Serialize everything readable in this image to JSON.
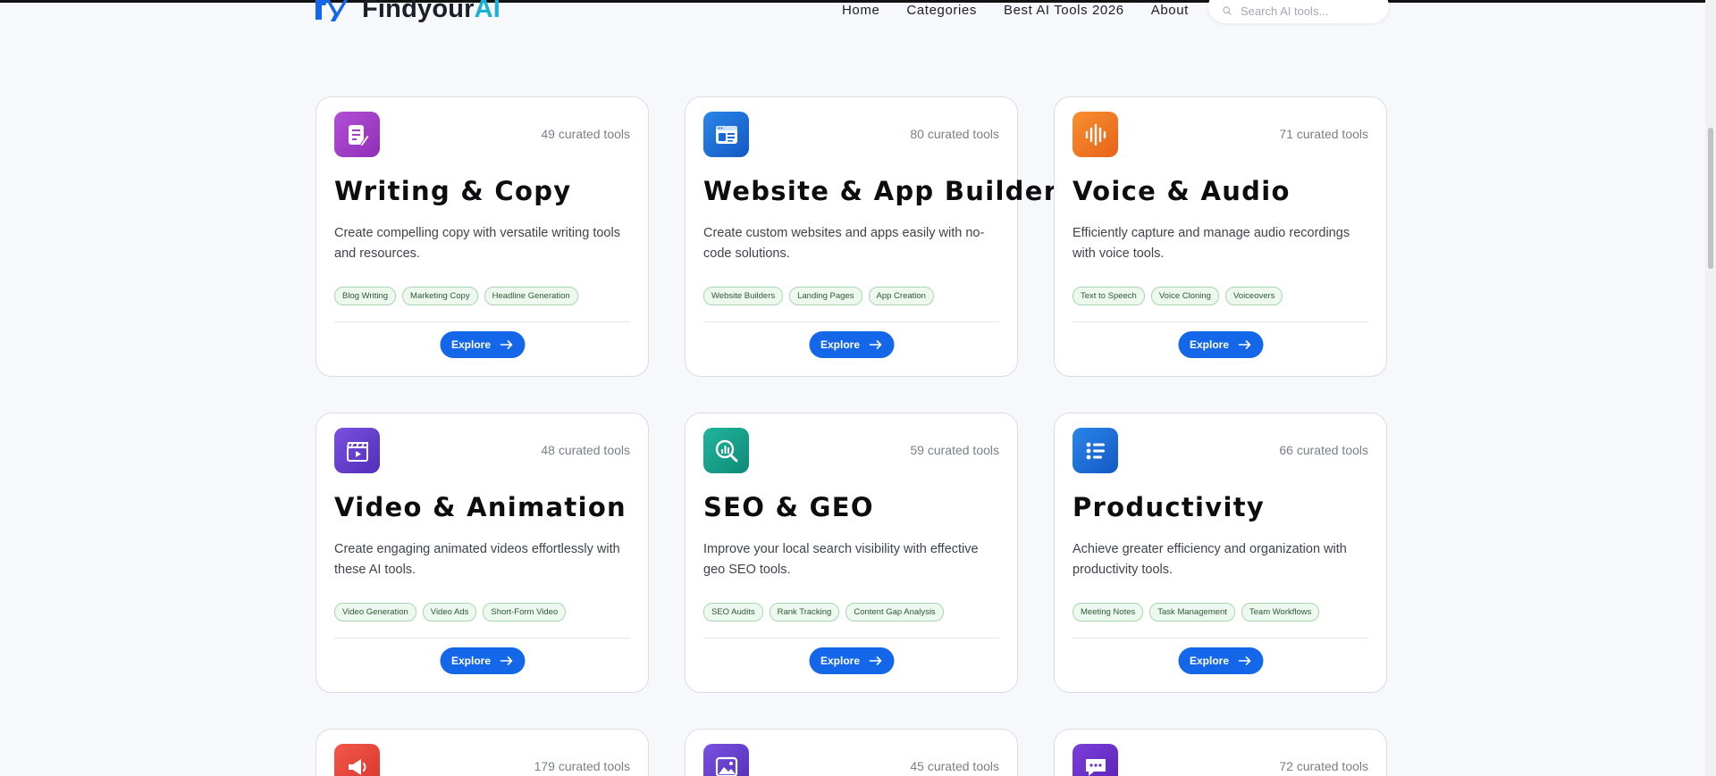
{
  "header": {
    "logo_text": "Findyour",
    "logo_accent": "AI",
    "nav": [
      "Home",
      "Categories",
      "Best AI Tools 2026",
      "About"
    ],
    "search_placeholder": "Search AI tools..."
  },
  "explore_label": "Explore",
  "cards": [
    {
      "count": "49 curated tools",
      "title": "Writing & Copy",
      "desc": "Create compelling copy with versatile writing tools and resources.",
      "tags": [
        "Blog Writing",
        "Marketing Copy",
        "Headline Generation"
      ],
      "icon": "writing-icon",
      "color": "#a23fc8"
    },
    {
      "count": "80 curated tools",
      "title": "Website & App Builder",
      "desc": "Create custom websites and apps easily with no-code solutions.",
      "tags": [
        "Website Builders",
        "Landing Pages",
        "App Creation"
      ],
      "icon": "website-icon",
      "color": "#1768d8"
    },
    {
      "count": "71 curated tools",
      "title": "Voice & Audio",
      "desc": "Efficiently capture and manage audio recordings with voice tools.",
      "tags": [
        "Text to Speech",
        "Voice Cloning",
        "Voiceovers"
      ],
      "icon": "audio-wave-icon",
      "color": "#f07a1a"
    },
    {
      "count": "48 curated tools",
      "title": "Video & Animation",
      "desc": "Create engaging animated videos effortlessly with these AI tools.",
      "tags": [
        "Video Generation",
        "Video Ads",
        "Short-Form Video"
      ],
      "icon": "video-clapper-icon",
      "color": "#6a3fd0"
    },
    {
      "count": "59 curated tools",
      "title": "SEO & GEO",
      "desc": "Improve your local search visibility with effective geo SEO tools.",
      "tags": [
        "SEO Audits",
        "Rank Tracking",
        "Content Gap Analysis"
      ],
      "icon": "search-chart-icon",
      "color": "#15a08c"
    },
    {
      "count": "66 curated tools",
      "title": "Productivity",
      "desc": "Achieve greater efficiency and organization with productivity tools.",
      "tags": [
        "Meeting Notes",
        "Task Management",
        "Team Workflows"
      ],
      "icon": "checklist-icon",
      "color": "#1768d8"
    },
    {
      "count": "179 curated tools",
      "icon": "megaphone-icon",
      "color": "#e8453a"
    },
    {
      "count": "45 curated tools",
      "icon": "image-icon",
      "color": "#6a3fd0"
    },
    {
      "count": "72 curated tools",
      "icon": "chat-icon",
      "color": "#6a2fc6"
    }
  ]
}
